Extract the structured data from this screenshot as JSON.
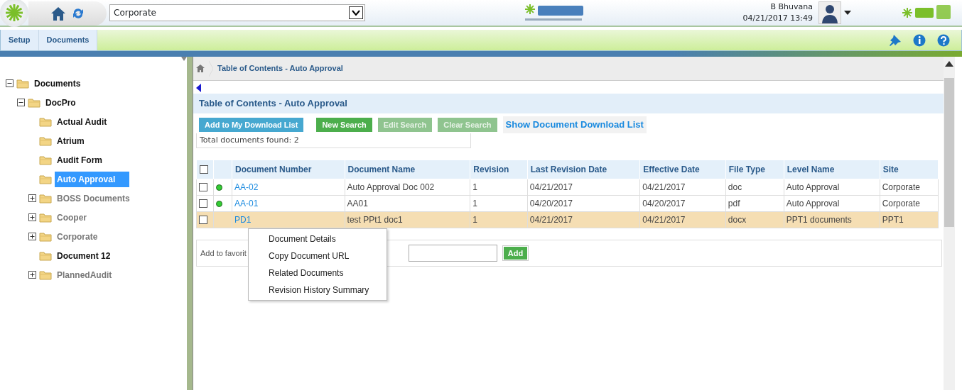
{
  "header": {
    "site_select": "Corporate",
    "user_name": "B Bhuvana",
    "datetime": "04/21/2017 13:49"
  },
  "menu": [
    {
      "label": "Setup",
      "selected": false
    },
    {
      "label": "Documents",
      "selected": false
    }
  ],
  "tree": [
    {
      "label": "Documents",
      "kind": "branch",
      "expanded": true,
      "selected": false,
      "children": [
        {
          "label": "DocPro",
          "kind": "branch",
          "expanded": true,
          "selected": false,
          "children": [
            {
              "label": "Actual Audit",
              "kind": "leaf",
              "selected": false
            },
            {
              "label": "Atrium",
              "kind": "leaf",
              "selected": false
            },
            {
              "label": "Audit Form",
              "kind": "leaf",
              "selected": false
            },
            {
              "label": "Auto Approval",
              "kind": "leaf",
              "selected": true
            },
            {
              "label": "BOSS Documents",
              "kind": "branch",
              "expanded": false,
              "selected": false
            },
            {
              "label": "Cooper",
              "kind": "branch",
              "expanded": false,
              "selected": false
            },
            {
              "label": "Corporate",
              "kind": "branch",
              "expanded": false,
              "selected": false
            },
            {
              "label": "Document 12",
              "kind": "leaf",
              "selected": false
            },
            {
              "label": "PlannedAudit",
              "kind": "branch",
              "expanded": false,
              "selected": false
            }
          ]
        }
      ]
    }
  ],
  "breadcrumb": "Table of Contents - Auto Approval",
  "panel_title": "Table of Contents - Auto Approval",
  "buttons": [
    {
      "label": "Add to My Download List",
      "kind": "info",
      "disabled": false
    },
    {
      "label": "New Search",
      "kind": "success",
      "disabled": false
    },
    {
      "label": "Edit Search",
      "kind": "success",
      "disabled": true
    },
    {
      "label": "Clear Search",
      "kind": "success",
      "disabled": true
    }
  ],
  "download_link": "Show Document Download List",
  "total": "Total documents found: 2",
  "table": {
    "select_all_checked": false,
    "columns": [
      "Document Number",
      "Document Name",
      "Revision",
      "Last Revision Date",
      "Effective Date",
      "File Type",
      "Level Name",
      "Site"
    ],
    "rows": [
      {
        "checked": false,
        "status_dot": true,
        "selected": false,
        "cells": [
          "AA-02",
          "Auto Approval Doc 002",
          "1",
          "04/21/2017",
          "04/21/2017",
          "doc",
          "Auto Approval",
          "Corporate"
        ]
      },
      {
        "checked": false,
        "status_dot": true,
        "selected": false,
        "cells": [
          "AA-01",
          "AA01",
          "1",
          "04/20/2017",
          "04/20/2017",
          "pdf",
          "Auto Approval",
          "Corporate"
        ]
      },
      {
        "checked": false,
        "status_dot": false,
        "selected": true,
        "cells": [
          "PD1",
          "test PPt1 doc1",
          "1",
          "04/21/2017",
          "04/21/2017",
          "docx",
          "PPT1 documents",
          "PPT1"
        ]
      }
    ]
  },
  "favorites": {
    "label": "Add to favorit",
    "button": "Add"
  },
  "context_menu": [
    "Document Details",
    "Copy Document URL",
    "Related Documents",
    "Revision History Summary"
  ]
}
